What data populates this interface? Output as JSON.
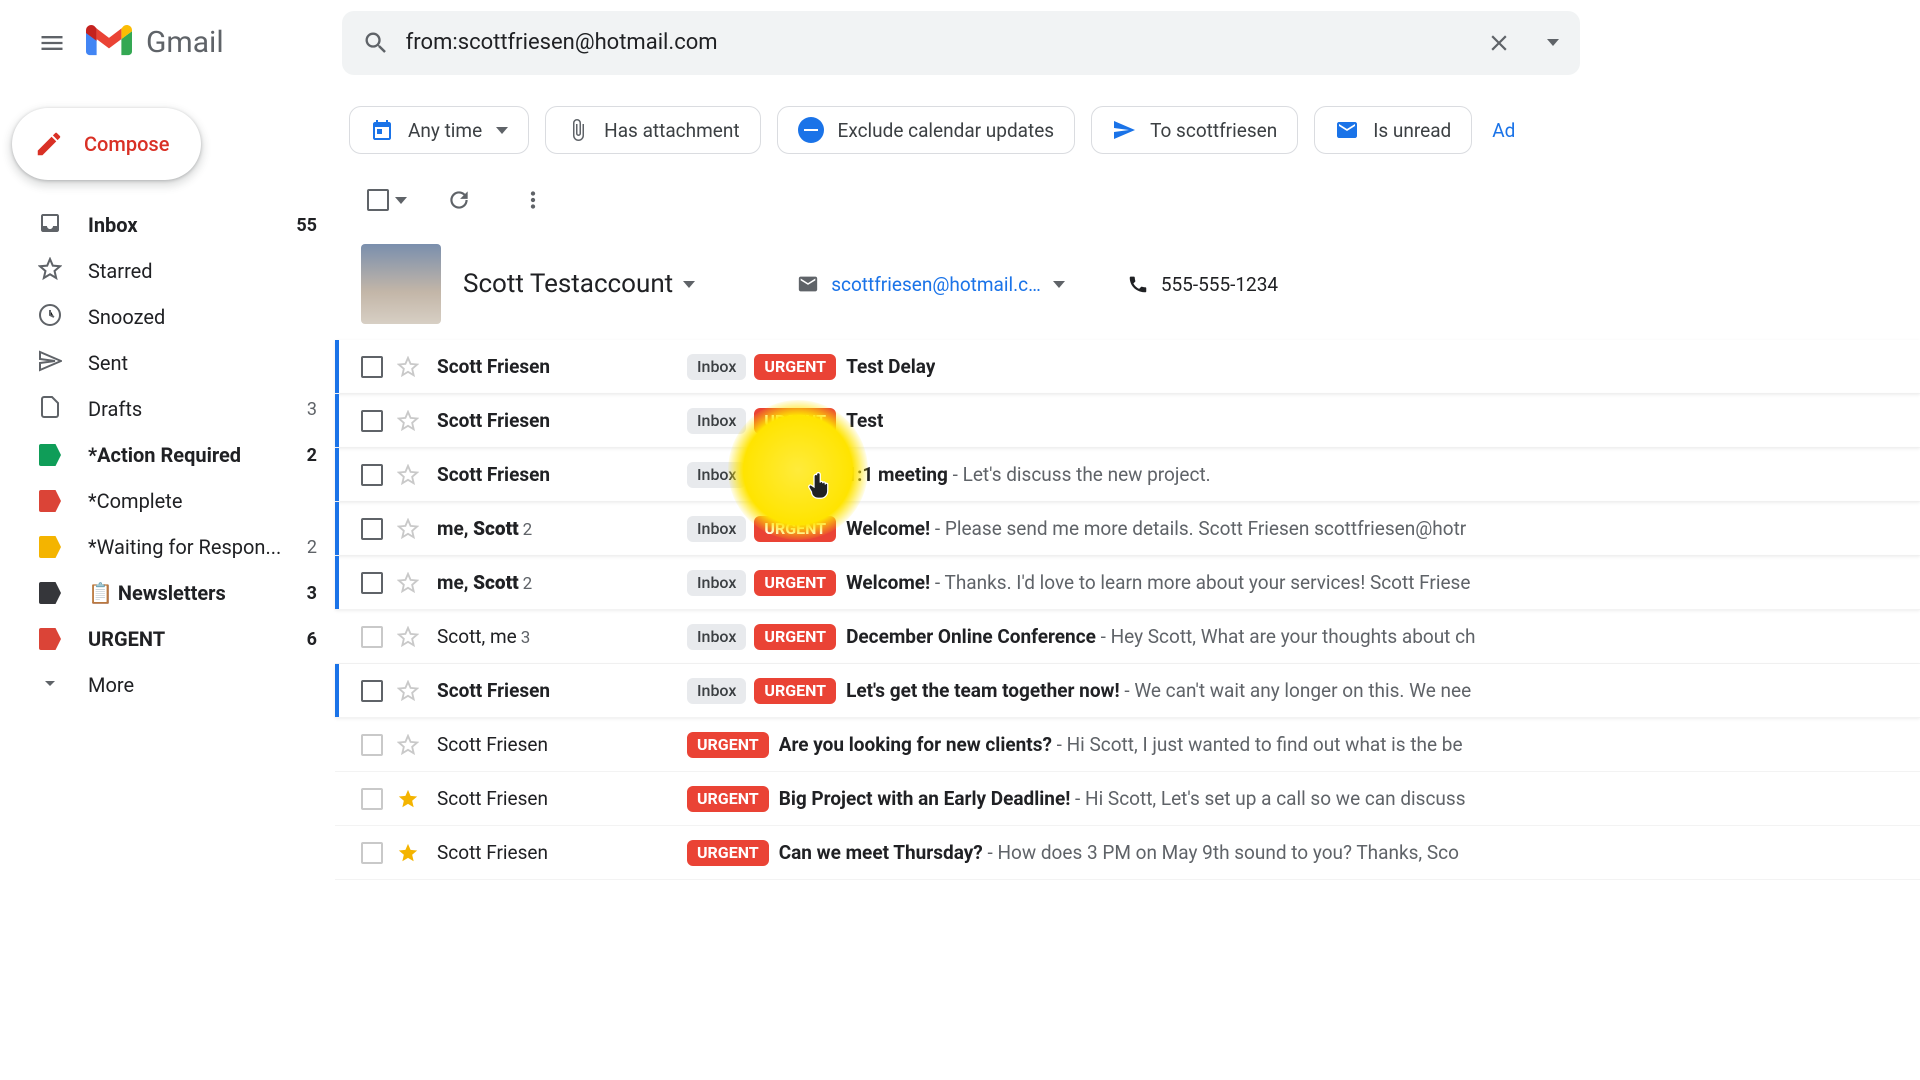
{
  "header": {
    "product_name": "Gmail",
    "search_value": "from:scottfriesen@hotmail.com"
  },
  "compose_label": "Compose",
  "sidebar": [
    {
      "icon": "inbox",
      "label": "Inbox",
      "count": "55",
      "bold": true
    },
    {
      "icon": "star",
      "label": "Starred",
      "count": "",
      "bold": false
    },
    {
      "icon": "clock",
      "label": "Snoozed",
      "count": "",
      "bold": false
    },
    {
      "icon": "send",
      "label": "Sent",
      "count": "",
      "bold": false
    },
    {
      "icon": "file",
      "label": "Drafts",
      "count": "3",
      "bold": false
    },
    {
      "icon": "tag-green",
      "label": "*Action Required",
      "count": "2",
      "bold": true
    },
    {
      "icon": "tag-red",
      "label": "*Complete",
      "count": "",
      "bold": false
    },
    {
      "icon": "tag-yellow",
      "label": "*Waiting for Respon...",
      "count": "2",
      "bold": false
    },
    {
      "icon": "tag-dark",
      "label": "📋 Newsletters",
      "count": "3",
      "bold": true
    },
    {
      "icon": "tag-red",
      "label": "URGENT",
      "count": "6",
      "bold": true
    },
    {
      "icon": "expand",
      "label": "More",
      "count": "",
      "bold": false
    }
  ],
  "chips": {
    "any_time": "Any time",
    "has_attachment": "Has attachment",
    "exclude_calendar": "Exclude calendar updates",
    "to": "To scottfriesen",
    "is_unread": "Is unread",
    "advanced": "Ad"
  },
  "contact": {
    "name": "Scott Testaccount",
    "email": "scottfriesen@hotmail.c…",
    "phone": "555-555-1234"
  },
  "labels": {
    "inbox": "Inbox",
    "urgent": "URGENT"
  },
  "rows": [
    {
      "unread": true,
      "starred": false,
      "sender": "Scott Friesen",
      "count": "",
      "inbox": true,
      "urgent": true,
      "subject": "Test Delay",
      "snippet": ""
    },
    {
      "unread": true,
      "starred": false,
      "sender": "Scott Friesen",
      "count": "",
      "inbox": true,
      "urgent": true,
      "subject": "Test",
      "snippet": ""
    },
    {
      "unread": true,
      "starred": false,
      "sender": "Scott Friesen",
      "count": "",
      "inbox": true,
      "urgent": true,
      "subject": "1:1 meeting",
      "snippet": "Let's discuss the new project."
    },
    {
      "unread": true,
      "starred": false,
      "sender": "me, <b>Scott</b>",
      "count": "2",
      "inbox": true,
      "urgent": true,
      "subject": "Welcome!",
      "snippet": "Please send me more details. Scott Friesen scottfriesen@hotr"
    },
    {
      "unread": true,
      "starred": false,
      "sender": "me, <b>Scott</b>",
      "count": "2",
      "inbox": true,
      "urgent": true,
      "subject": "Welcome!",
      "snippet": "Thanks. I'd love to learn more about your services! Scott Friese"
    },
    {
      "unread": false,
      "starred": false,
      "sender": "Scott, me",
      "count": "3",
      "inbox": true,
      "urgent": true,
      "subject": "December Online Conference",
      "snippet": "Hey Scott, What are your thoughts about ch"
    },
    {
      "unread": true,
      "starred": false,
      "sender": "Scott Friesen",
      "count": "",
      "inbox": true,
      "urgent": true,
      "subject": "Let's get the team together now!",
      "snippet": "We can't wait any longer on this. We nee"
    },
    {
      "unread": false,
      "starred": false,
      "sender": "Scott Friesen",
      "count": "",
      "inbox": false,
      "urgent": true,
      "subject": "Are you looking for new clients?",
      "snippet": "Hi Scott, I just wanted to find out what is the be"
    },
    {
      "unread": false,
      "starred": true,
      "sender": "Scott Friesen",
      "count": "",
      "inbox": false,
      "urgent": true,
      "subject": "Big Project with an Early Deadline!",
      "snippet": "Hi Scott, Let's set up a call so we can discuss"
    },
    {
      "unread": false,
      "starred": true,
      "sender": "Scott Friesen",
      "count": "",
      "inbox": false,
      "urgent": true,
      "subject": "Can we meet Thursday?",
      "snippet": "How does 3 PM on May 9th sound to you? Thanks, Sco"
    }
  ]
}
